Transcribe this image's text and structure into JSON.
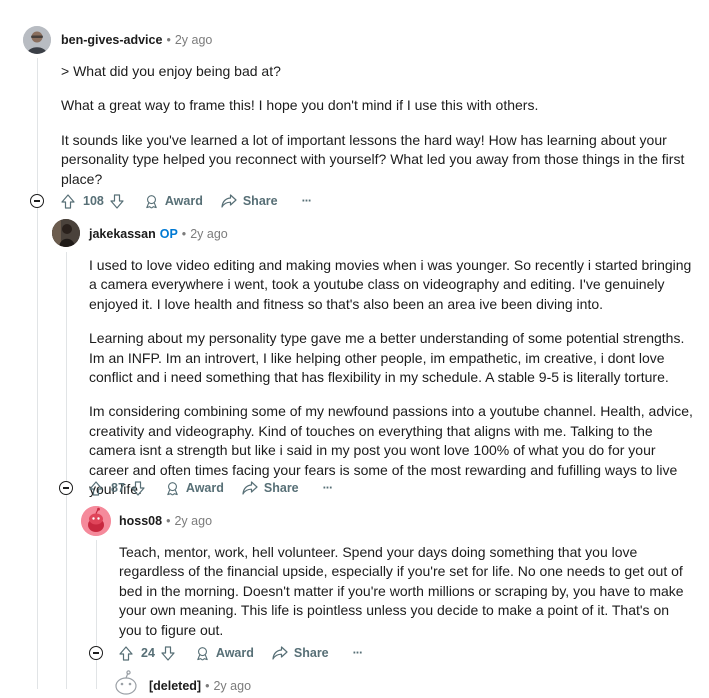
{
  "comments": [
    {
      "username": "ben-gives-advice",
      "age": "2y ago",
      "paragraphs": [
        "> What did you enjoy being bad at?",
        "What a great way to frame this! I hope you don't mind if I use this with others.",
        "It sounds like you've learned a lot of important lessons the hard way! How has learning about your personality type helped you reconnect with yourself? What led you away from those things in the first place?"
      ],
      "score": "108",
      "award_label": "Award",
      "share_label": "Share",
      "more_label": "···"
    },
    {
      "username": "jakekassan",
      "op_badge": "OP",
      "age": "2y ago",
      "paragraphs": [
        "I used to love video editing and making movies when i was younger. So recently i started bringing a camera everywhere i went, took a youtube class on videography and editing. I've genuinely enjoyed it. I love health and fitness so that's also been an area ive been diving into.",
        "Learning about my personality type gave me a better understanding of some potential strengths. Im an INFP. Im an introvert, I like helping other people, im empathetic, im creative, i dont love conflict and i need something that has flexibility in my schedule. A stable 9-5 is literally torture.",
        "Im considering combining some of my newfound passions into a youtube channel. Health, advice, creativity and videography. Kind of touches on everything that aligns with me. Talking to the camera isnt a strength but like i said in my post you wont love 100% of what you do for your career and often times facing your fears is some of the most rewarding and fufilling ways to live your life."
      ],
      "score": "87",
      "award_label": "Award",
      "share_label": "Share",
      "more_label": "···"
    },
    {
      "username": "hoss08",
      "age": "2y ago",
      "paragraphs": [
        "Teach, mentor, work, hell volunteer. Spend your days doing something that you love regardless of the financial upside, especially if you're set for life. No one needs to get out of bed in the morning. Doesn't matter if you're worth millions or scraping by, you have to make your own meaning. This life is pointless unless you decide to make a point of it. That's on you to figure out."
      ],
      "score": "24",
      "award_label": "Award",
      "share_label": "Share",
      "more_label": "···"
    },
    {
      "username": "[deleted]",
      "age": "2y ago"
    }
  ],
  "separator": "•",
  "colors": {
    "text": "#1c1c1c",
    "meta": "#7c7c7c",
    "action": "#576f76",
    "op": "#0079d3",
    "thread_line": "#e1e4e6",
    "snoo_avatar": "#f58a9b"
  }
}
